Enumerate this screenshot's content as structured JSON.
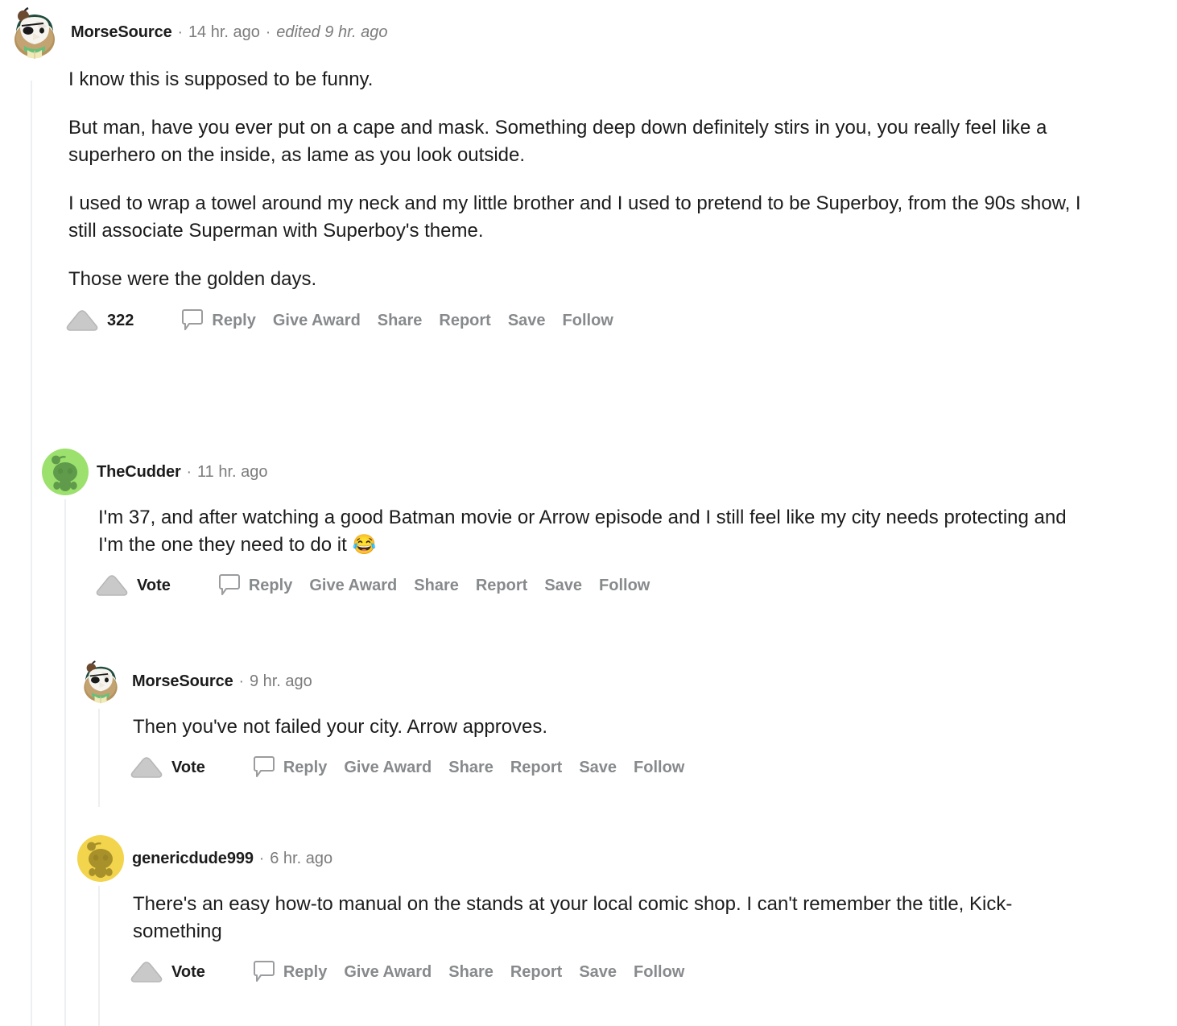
{
  "colors": {
    "text": "#1c1c1c",
    "muted": "#7c7c7c",
    "action": "#878a8c",
    "threadline": "#edeff1",
    "avatar_green_bg": "#9ce06d",
    "avatar_green_fg": "#5f9b4a",
    "avatar_yellow_bg": "#f2d44d",
    "avatar_yellow_fg": "#a8902a",
    "vote_icon": "#c8c8c8"
  },
  "comments": [
    {
      "id": "c1",
      "depth": 0,
      "author": "MorseSource",
      "separator": "·",
      "timestamp": "14 hr. ago",
      "edited": "edited 9 hr. ago",
      "avatar": "morsesource-avatar",
      "paragraphs": [
        "I know this is supposed to be funny.",
        "But man, have you ever put on a cape and mask. Something deep down definitely stirs in you, you really feel like a superhero on the inside, as lame as you look outside.",
        "I used to wrap a towel around my neck and my little brother and I used to pretend to be Superboy, from the 90s show, I still associate Superman with Superboy's theme.",
        "Those were the golden days."
      ],
      "vote_label": "322",
      "has_score": true,
      "actions": [
        "Reply",
        "Give Award",
        "Share",
        "Report",
        "Save",
        "Follow"
      ]
    },
    {
      "id": "c2",
      "depth": 1,
      "author": "TheCudder",
      "separator": "·",
      "timestamp": "11 hr. ago",
      "edited": "",
      "avatar": "snoo-green-avatar",
      "paragraphs": [
        "I'm 37, and after watching a good Batman movie or Arrow episode and I still feel like my city needs protecting and I'm the one they need to do it 😂"
      ],
      "vote_label": "Vote",
      "has_score": false,
      "actions": [
        "Reply",
        "Give Award",
        "Share",
        "Report",
        "Save",
        "Follow"
      ]
    },
    {
      "id": "c3",
      "depth": 2,
      "author": "MorseSource",
      "separator": "·",
      "timestamp": "9 hr. ago",
      "edited": "",
      "avatar": "morsesource-avatar",
      "paragraphs": [
        "Then you've not failed your city. Arrow approves."
      ],
      "vote_label": "Vote",
      "has_score": false,
      "actions": [
        "Reply",
        "Give Award",
        "Share",
        "Report",
        "Save",
        "Follow"
      ]
    },
    {
      "id": "c4",
      "depth": 2,
      "author": "genericdude999",
      "separator": "·",
      "timestamp": "6 hr. ago",
      "edited": "",
      "avatar": "snoo-yellow-avatar",
      "paragraphs": [
        "There's an easy how-to manual on the stands at your local comic shop. I can't remember the title, Kick-something"
      ],
      "vote_label": "Vote",
      "has_score": false,
      "actions": [
        "Reply",
        "Give Award",
        "Share",
        "Report",
        "Save",
        "Follow"
      ]
    }
  ]
}
